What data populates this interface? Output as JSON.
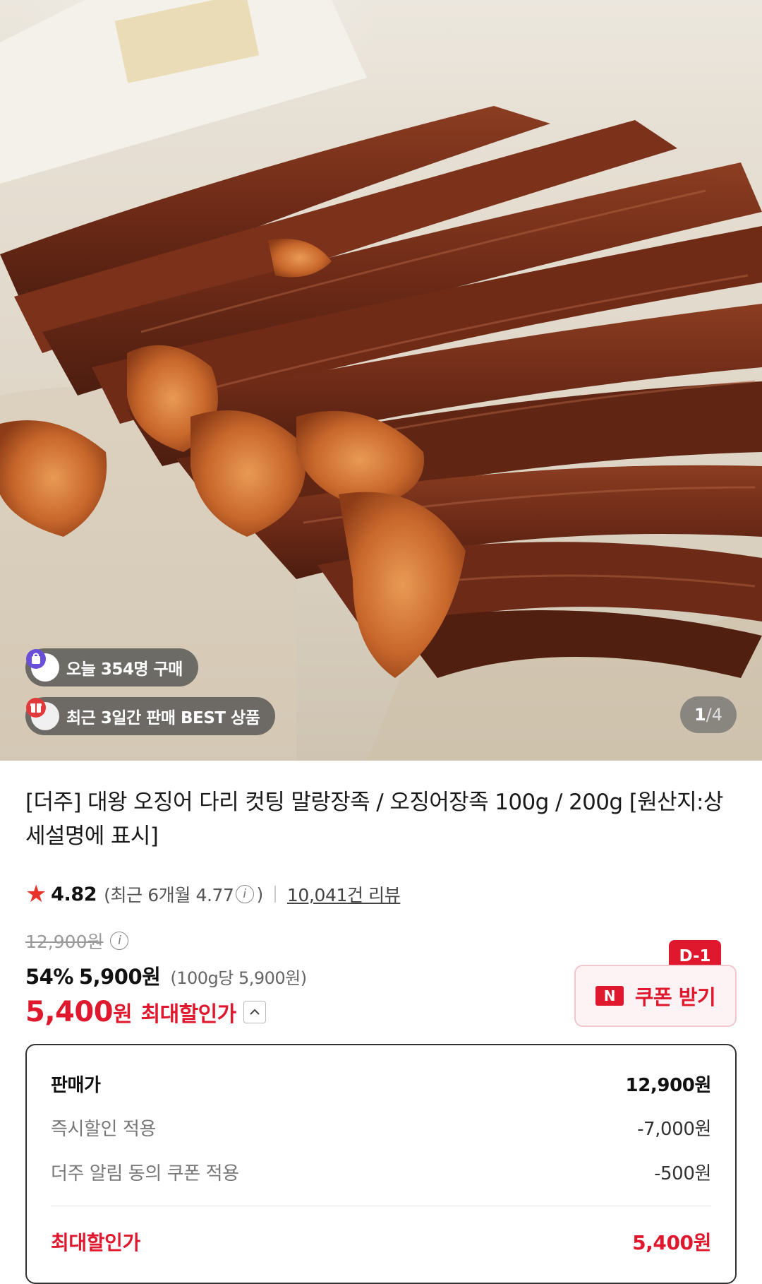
{
  "image": {
    "badges": {
      "today": "오늘 354명 구매",
      "best": "최근 3일간 판매 BEST 상품"
    },
    "pager": {
      "current": "1",
      "separator": "/",
      "total": "4"
    }
  },
  "product": {
    "title": "[더주] 대왕 오징어 다리 컷팅 말랑장족 / 오징어장족 100g / 200g [원산지:상세설명에 표시]",
    "rating": "4.82",
    "rating_recent_prefix": "(최근 6개월 4.77",
    "rating_recent_suffix": ")",
    "reviews": "10,041건 리뷰",
    "original_price": "12,900원",
    "discount_percent": "54%",
    "sale_price": "5,900원",
    "unit_price": "(100g당 5,900원)",
    "final_price": "5,400",
    "final_price_unit": "원",
    "final_price_label": "최대할인가"
  },
  "coupon": {
    "logo": "N",
    "label": "쿠폰 받기",
    "deadline": "D-1"
  },
  "breakdown": {
    "rows": [
      {
        "label": "판매가",
        "value": "12,900원"
      },
      {
        "label": "즉시할인 적용",
        "value": "-7,000원"
      },
      {
        "label": "더주 알림 동의 쿠폰 적용",
        "value": "-500원"
      }
    ],
    "total": {
      "label": "최대할인가",
      "value": "5,400원"
    }
  },
  "colors": {
    "accent_red": "#e0182d",
    "star": "#e8332a",
    "badge_bag_icon": "#6a4fd8",
    "badge_gift_icon": "#e23a3a"
  }
}
